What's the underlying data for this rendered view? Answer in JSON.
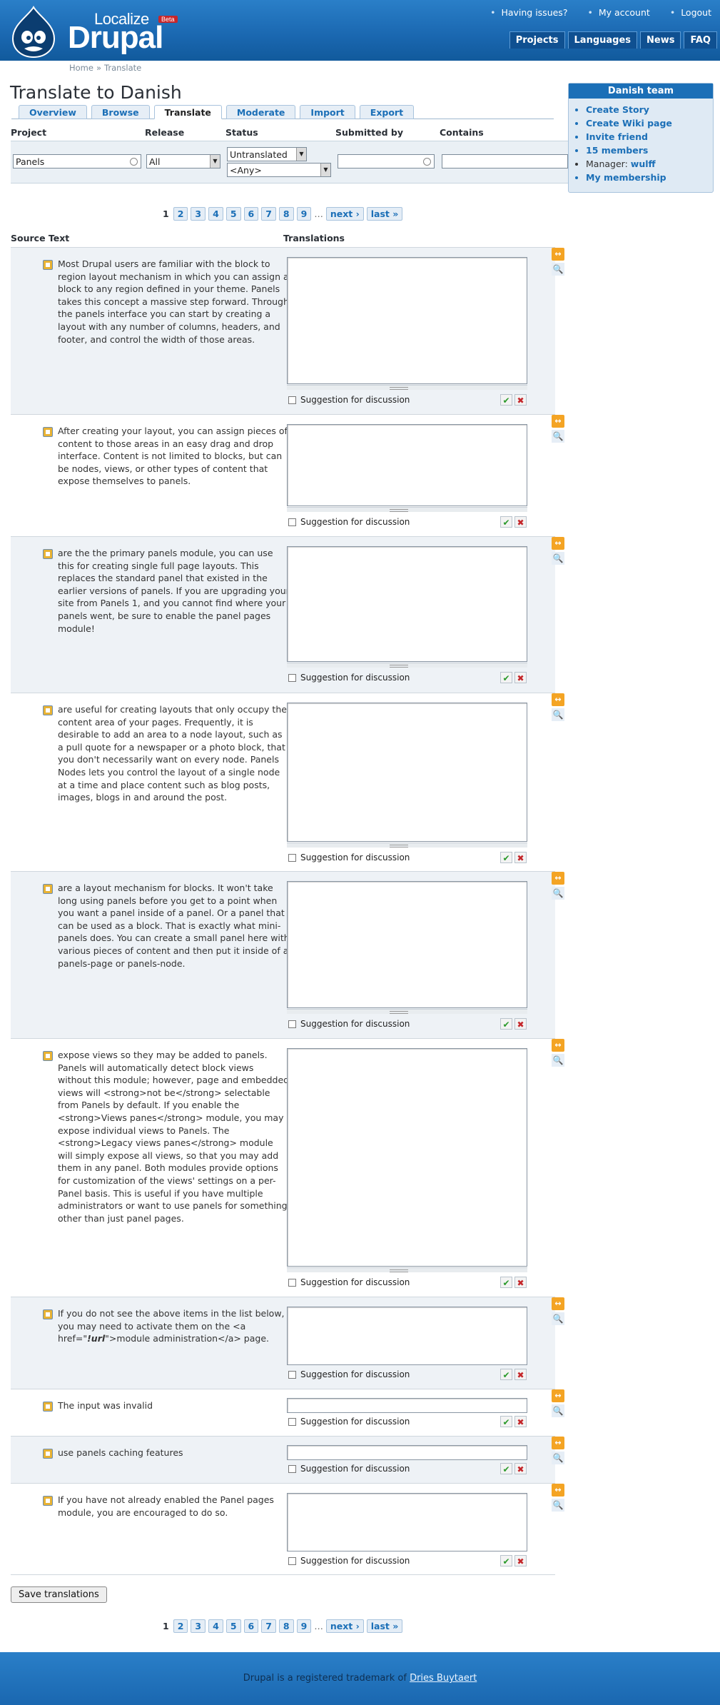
{
  "brand": {
    "localize": "Localize",
    "beta": "Beta",
    "drupal": "Drupal"
  },
  "top_links": [
    "Having issues?",
    "My account",
    "Logout"
  ],
  "main_nav": [
    "Projects",
    "Languages",
    "News",
    "FAQ"
  ],
  "breadcrumb": [
    "Home",
    "Translate"
  ],
  "page_title": "Translate to Danish",
  "tabs": [
    "Overview",
    "Browse",
    "Translate",
    "Moderate",
    "Import",
    "Export"
  ],
  "active_tab": "Translate",
  "filter": {
    "labels": [
      "Project",
      "Release",
      "Status",
      "Submitted by",
      "Contains"
    ],
    "project_value": "Panels",
    "release_value": "All",
    "status_value": "Untranslated",
    "status_any": "<Any>",
    "submitted_value": "",
    "contains_value": ""
  },
  "pager": {
    "current": "1",
    "pages": [
      "2",
      "3",
      "4",
      "5",
      "6",
      "7",
      "8",
      "9"
    ],
    "dots": "…",
    "next": "next ›",
    "last": "last »"
  },
  "columns": {
    "source": "Source Text",
    "translations": "Translations"
  },
  "rows": [
    {
      "source": "Most Drupal users are familiar with the block to region layout mechanism in which you can assign a block to any region defined in your theme. Panels takes this concept a massive step forward. Through the panels interface you can start by creating a layout with any number of columns, headers, and footer, and control the width of those areas."
    },
    {
      "source": "After creating your layout, you can assign pieces of content to those areas in an easy drag and drop interface. Content is not limited to blocks, but can be nodes, views, or other types of content that expose themselves to panels."
    },
    {
      "source": "are the the primary panels module, you can use this for creating single full page layouts. This replaces the standard panel that existed in the earlier versions of panels. If you are upgrading your site from Panels 1, and you cannot find where your panels went, be sure to enable the panel pages module!"
    },
    {
      "source": "are useful for creating layouts that only occupy the content area of your pages. Frequently, it is desirable to add an area to a node layout, such as a pull quote for a newspaper or a photo block, that you don't necessarily want on every node. Panels Nodes lets you control the layout of a single node at a time and place content such as blog posts, images, blogs in and around the post."
    },
    {
      "source": "are a layout mechanism for blocks. It won't take long using panels before you get to a point when you want a panel inside of a panel. Or a panel that can be used as a block. That is exactly what mini-panels does. You can create a small panel here with various pieces of content and then put it inside of a panels-page or panels-node."
    },
    {
      "source": "expose views so they may be added to panels. Panels will automatically detect block views without this module; however, page and embedded views will <strong>not be</strong> selectable from Panels by default. If you enable the <strong>Views panes</strong> module, you may expose individual views to Panels. The <strong>Legacy views panes</strong> module will simply expose all views, so that you may add them in any panel. Both modules provide options for customization of the views' settings on a per-Panel basis. This is useful if you have multiple administrators or want to use panels for something other than just panel pages."
    },
    {
      "source": "If you do not see the above items in the list below, you may need to activate them on the <a href=\"",
      "source_em": "!url",
      "source_tail": "\">module administration</a> page."
    },
    {
      "source": "The input was invalid"
    },
    {
      "source": "use panels caching features"
    },
    {
      "source": "If you have not already enabled the Panel pages module, you are encouraged to do so."
    }
  ],
  "suggestion_label": "Suggestion for discussion",
  "save_label": "Save translations",
  "sidebar": {
    "title": "Danish team",
    "links": [
      "Create Story",
      "Create Wiki page",
      "Invite friend",
      "15 members"
    ],
    "manager_label": "Manager:",
    "manager_name": "wulff",
    "membership": "My membership"
  },
  "footer": {
    "text": "Drupal is a registered trademark of",
    "link": "Dries Buytaert"
  },
  "colors": {
    "brand_blue": "#1a67b0",
    "link_blue": "#1b6fb7",
    "accent_orange": "#f4a424"
  }
}
